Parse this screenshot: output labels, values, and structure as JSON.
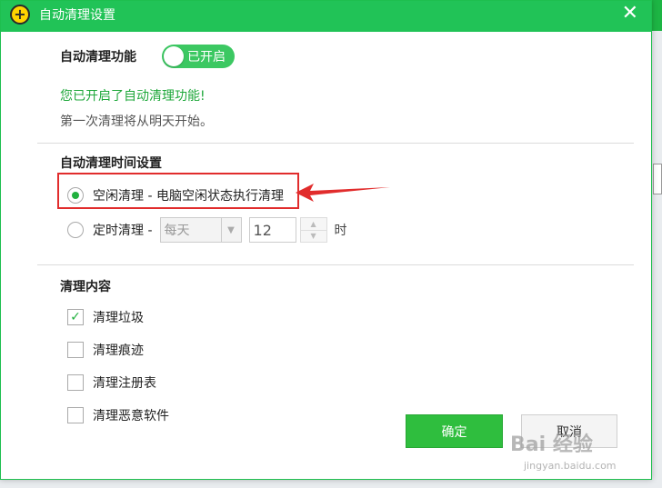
{
  "window": {
    "title": "自动清理设置",
    "close_symbol": "✕"
  },
  "auto_clean": {
    "label": "自动清理功能",
    "toggle_text": "已开启",
    "enabled_msg": "您已开启了自动清理功能!",
    "start_msg": "第一次清理将从明天开始。"
  },
  "time_settings": {
    "title": "自动清理时间设置",
    "idle_option": "空闲清理 - 电脑空闲状态执行清理",
    "scheduled_option": "定时清理 -",
    "frequency_value": "每天",
    "hour_value": "12",
    "hour_unit": "时"
  },
  "content": {
    "title": "清理内容",
    "items": [
      {
        "label": "清理垃圾",
        "checked": true
      },
      {
        "label": "清理痕迹",
        "checked": false
      },
      {
        "label": "清理注册表",
        "checked": false
      },
      {
        "label": "清理恶意软件",
        "checked": false
      }
    ]
  },
  "buttons": {
    "ok": "确定",
    "cancel": "取消"
  },
  "watermark": {
    "main": "Bai 经验",
    "sub": "jingyan.baidu.com"
  },
  "colors": {
    "accent": "#21c357",
    "highlight": "#e12c2c"
  }
}
